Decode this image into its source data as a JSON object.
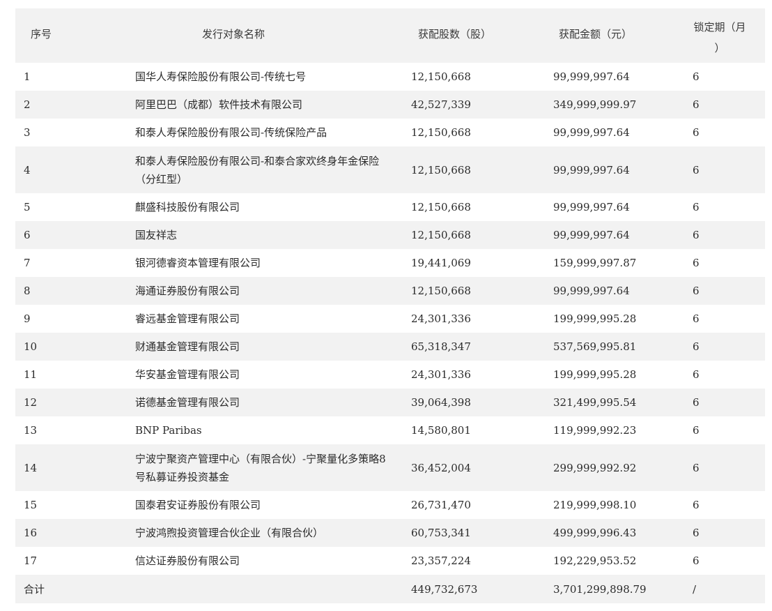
{
  "table": {
    "headers": {
      "index": "序号",
      "name": "发行对象名称",
      "shares": "获配股数（股）",
      "amount": "获配金额（元）",
      "lock_line1": "锁定期（月",
      "lock_line2": "）"
    },
    "rows": [
      {
        "index": "1",
        "name": "国华人寿保险股份有限公司-传统七号",
        "shares": "12,150,668",
        "amount": "99,999,997.64",
        "lock": "6"
      },
      {
        "index": "2",
        "name": "阿里巴巴（成都）软件技术有限公司",
        "shares": "42,527,339",
        "amount": "349,999,999.97",
        "lock": "6"
      },
      {
        "index": "3",
        "name": "和泰人寿保险股份有限公司-传统保险产品",
        "shares": "12,150,668",
        "amount": "99,999,997.64",
        "lock": "6"
      },
      {
        "index": "4",
        "name": "和泰人寿保险股份有限公司-和泰合家欢终身年金保险（分红型）",
        "shares": "12,150,668",
        "amount": "99,999,997.64",
        "lock": "6"
      },
      {
        "index": "5",
        "name": "麒盛科技股份有限公司",
        "shares": "12,150,668",
        "amount": "99,999,997.64",
        "lock": "6"
      },
      {
        "index": "6",
        "name": "国友祥志",
        "shares": "12,150,668",
        "amount": "99,999,997.64",
        "lock": "6"
      },
      {
        "index": "7",
        "name": "银河德睿资本管理有限公司",
        "shares": "19,441,069",
        "amount": "159,999,997.87",
        "lock": "6"
      },
      {
        "index": "8",
        "name": "海通证券股份有限公司",
        "shares": "12,150,668",
        "amount": "99,999,997.64",
        "lock": "6"
      },
      {
        "index": "9",
        "name": "睿远基金管理有限公司",
        "shares": "24,301,336",
        "amount": "199,999,995.28",
        "lock": "6"
      },
      {
        "index": "10",
        "name": "财通基金管理有限公司",
        "shares": "65,318,347",
        "amount": "537,569,995.81",
        "lock": "6"
      },
      {
        "index": "11",
        "name": "华安基金管理有限公司",
        "shares": "24,301,336",
        "amount": "199,999,995.28",
        "lock": "6"
      },
      {
        "index": "12",
        "name": "诺德基金管理有限公司",
        "shares": "39,064,398",
        "amount": "321,499,995.54",
        "lock": "6"
      },
      {
        "index": "13",
        "name": "BNP Paribas",
        "shares": "14,580,801",
        "amount": "119,999,992.23",
        "lock": "6"
      },
      {
        "index": "14",
        "name": "宁波宁聚资产管理中心（有限合伙）-宁聚量化多策略8号私募证券投资基金",
        "shares": "36,452,004",
        "amount": "299,999,992.92",
        "lock": "6"
      },
      {
        "index": "15",
        "name": "国泰君安证券股份有限公司",
        "shares": "26,731,470",
        "amount": "219,999,998.10",
        "lock": "6"
      },
      {
        "index": "16",
        "name": "宁波鸿煦投资管理合伙企业（有限合伙）",
        "shares": "60,753,341",
        "amount": "499,999,996.43",
        "lock": "6"
      },
      {
        "index": "17",
        "name": "信达证券股份有限公司",
        "shares": "23,357,224",
        "amount": "192,229,953.52",
        "lock": "6"
      }
    ],
    "total": {
      "label": "合计",
      "shares": "449,732,673",
      "amount": "3,701,299,898.79",
      "lock": "/"
    }
  }
}
